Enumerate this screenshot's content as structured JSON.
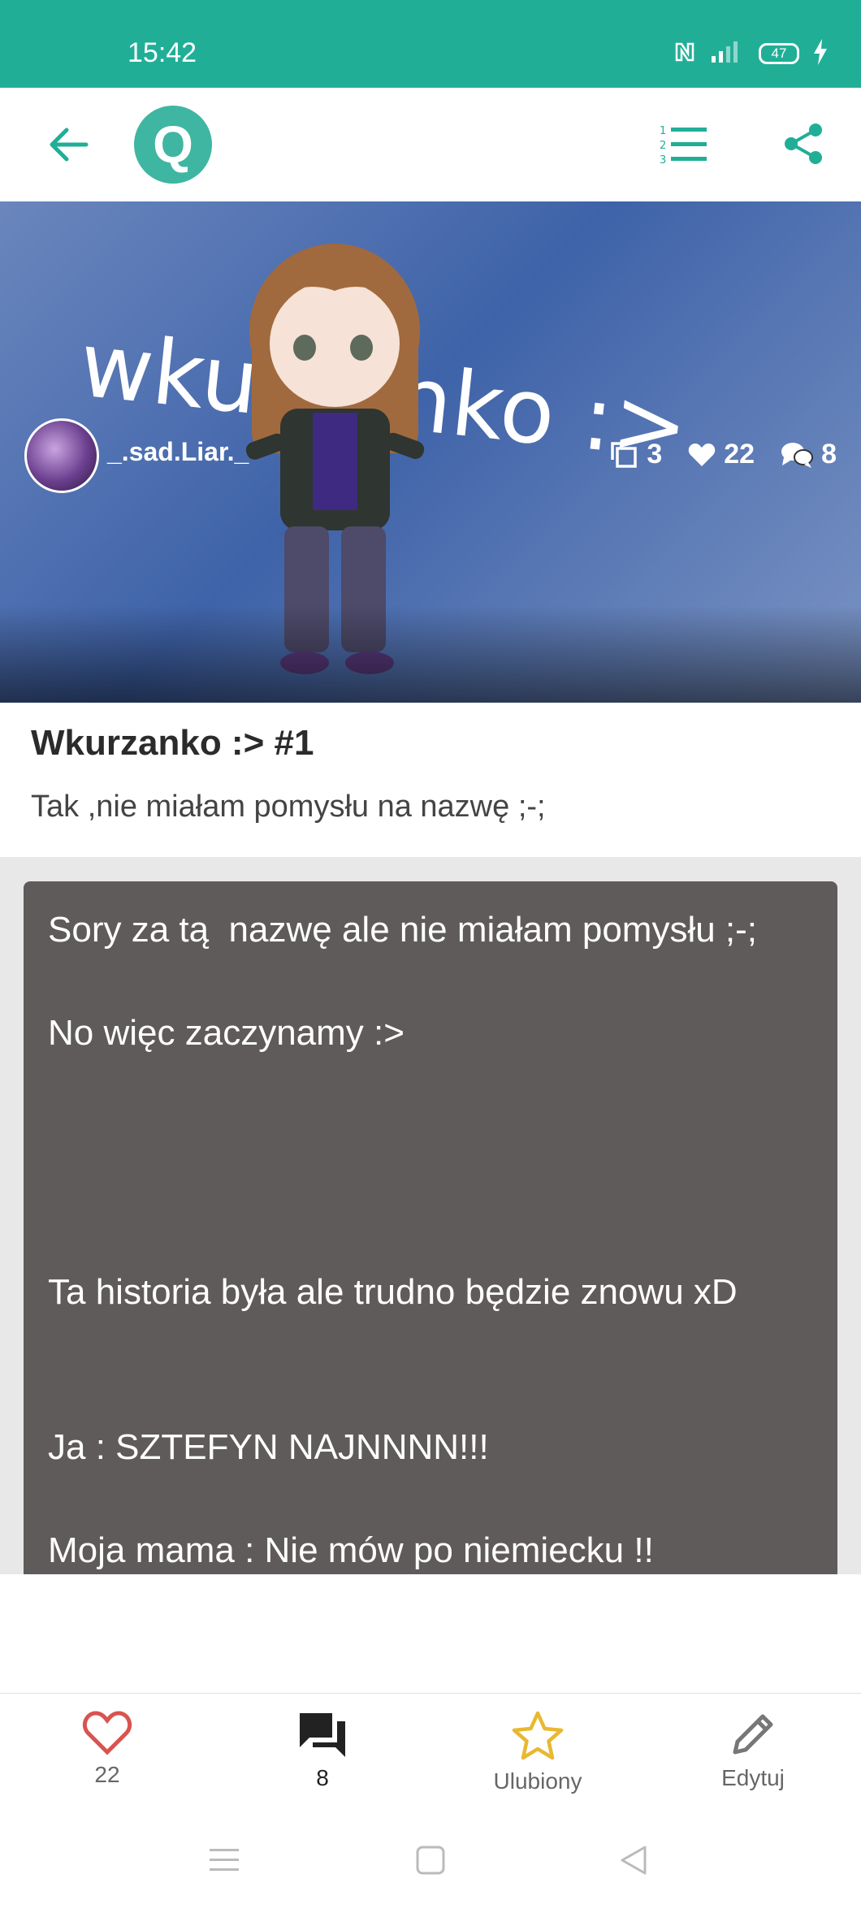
{
  "status_bar": {
    "time": "15:42",
    "battery": "47"
  },
  "app_bar": {
    "logo_letter": "Q"
  },
  "story": {
    "cover_text": "wkurzanko :>",
    "author": "_.sad.Liar._",
    "stats": {
      "parts": "3",
      "likes": "22",
      "comments": "8"
    },
    "title": "Wkurzanko :> #1",
    "subtitle": "Tak ,nie miałam pomysłu na nazwę ;-;"
  },
  "content_lines": [
    "Sory za tą  nazwę ale nie miałam pomysłu ;-;",
    "No więc zaczynamy :>",
    "Ta historia była ale trudno będzie znowu xD",
    "Ja : SZTEFYN NAJNNNN!!!",
    "Moja mama : Nie mów po niemiecku !!"
  ],
  "bottom_bar": {
    "likes": "22",
    "comments": "8",
    "favorite_label": "Ulubiony",
    "edit_label": "Edytuj"
  },
  "colors": {
    "accent": "#21ae97",
    "heart": "#d9534f",
    "star": "#e8b830",
    "card": "#605b5b"
  }
}
